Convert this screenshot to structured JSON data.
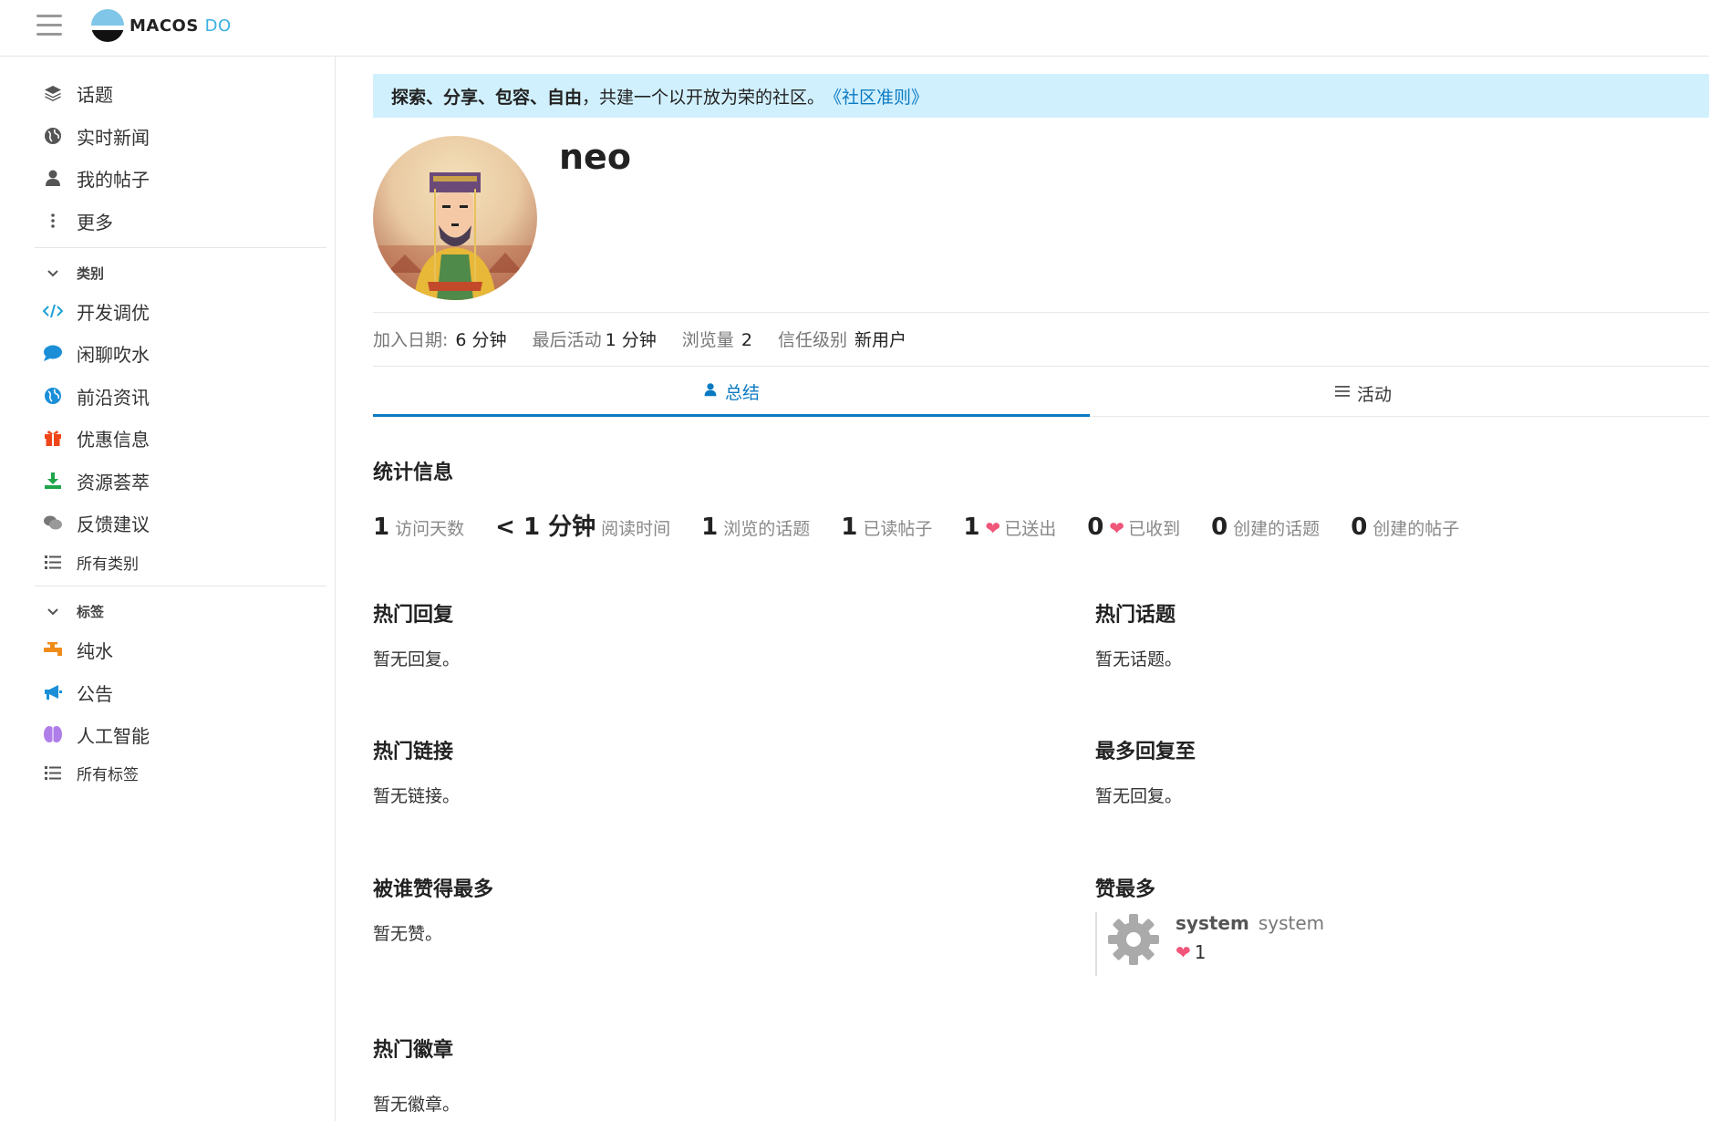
{
  "header": {
    "logo_text": "MACOS",
    "logo_accent": "DO"
  },
  "sidebar": {
    "top_items": [
      {
        "label": "话题",
        "icon": "layers-icon"
      },
      {
        "label": "实时新闻",
        "icon": "globe-icon"
      },
      {
        "label": "我的帖子",
        "icon": "user-icon"
      },
      {
        "label": "更多",
        "icon": "more-vertical-icon"
      }
    ],
    "categories_header": "类别",
    "categories": [
      {
        "label": "开发调优",
        "icon": "code-icon",
        "color": "#1da1d6"
      },
      {
        "label": "闲聊吹水",
        "icon": "chat-bubble-icon",
        "color": "#1a8fd8"
      },
      {
        "label": "前沿资讯",
        "icon": "globe-icon",
        "color": "#1a8fd8"
      },
      {
        "label": "优惠信息",
        "icon": "gift-icon",
        "color": "#f0451a"
      },
      {
        "label": "资源荟萃",
        "icon": "download-icon",
        "color": "#1fa44a"
      },
      {
        "label": "反馈建议",
        "icon": "comments-icon",
        "color": "#777777"
      }
    ],
    "all_categories": "所有类别",
    "tags_header": "标签",
    "tags": [
      {
        "label": "纯水",
        "icon": "faucet-icon",
        "color": "#f08c1a"
      },
      {
        "label": "公告",
        "icon": "megaphone-icon",
        "color": "#1a8fd8"
      },
      {
        "label": "人工智能",
        "icon": "brain-icon",
        "color": "#b07ee8"
      }
    ],
    "all_tags": "所有标签"
  },
  "banner": {
    "bold": "探索、分享、包容、自由",
    "text": "，共建一个以开放为荣的社区。",
    "link": "《社区准则》"
  },
  "profile": {
    "username": "neo",
    "meta": [
      {
        "label": "加入日期:",
        "value": "6 分钟"
      },
      {
        "label": "最后活动",
        "value": "1 分钟"
      },
      {
        "label": "浏览量",
        "value": "2"
      },
      {
        "label": "信任级别",
        "value": "新用户"
      }
    ]
  },
  "tabs": [
    {
      "label": "总结",
      "icon": "user-icon",
      "active": true
    },
    {
      "label": "活动",
      "icon": "list-icon",
      "active": false
    }
  ],
  "stats": {
    "title": "统计信息",
    "items": [
      {
        "num": "1",
        "label": "访问天数"
      },
      {
        "num": "< 1 分钟",
        "label": "阅读时间"
      },
      {
        "num": "1",
        "label": "浏览的话题"
      },
      {
        "num": "1",
        "label": "已读帖子"
      },
      {
        "num": "1",
        "label": "已送出",
        "heart": true
      },
      {
        "num": "0",
        "label": "已收到",
        "heart": true
      },
      {
        "num": "0",
        "label": "创建的话题"
      },
      {
        "num": "0",
        "label": "创建的帖子"
      }
    ]
  },
  "sections": {
    "top_replies": {
      "title": "热门回复",
      "empty": "暂无回复。"
    },
    "top_topics": {
      "title": "热门话题",
      "empty": "暂无话题。"
    },
    "top_links": {
      "title": "热门链接",
      "empty": "暂无链接。"
    },
    "most_replied_to": {
      "title": "最多回复至",
      "empty": "暂无回复。"
    },
    "most_liked_by": {
      "title": "被谁赞得最多",
      "empty": "暂无赞。"
    },
    "most_liked": {
      "title": "赞最多",
      "user_name": "system",
      "user_username": "system",
      "likes": "1"
    },
    "top_badges": {
      "title": "热门徽章",
      "empty": "暂无徽章。"
    }
  },
  "colors": {
    "accent": "#0a7ac2",
    "banner_bg": "#d1f0fd",
    "heart": "#f0557a"
  }
}
